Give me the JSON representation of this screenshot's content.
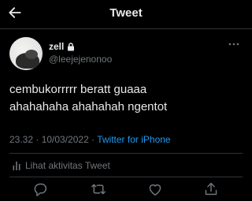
{
  "header": {
    "title": "Tweet"
  },
  "author": {
    "display_name": "zell",
    "handle": "@leejejenonoo"
  },
  "tweet": {
    "line1": "cembukorrrrr beratt guaaa",
    "line2": "ahahahaha ahahahah ngentot",
    "time": "23.32",
    "sep1": " · ",
    "date": "10/03/2022",
    "sep2": " · ",
    "source": "Twitter for iPhone"
  },
  "activity": {
    "label": "Lihat aktivitas Tweet"
  },
  "colors": {
    "background": "#000000",
    "accent": "#1d9bf0",
    "muted": "#71767b"
  },
  "icons": [
    "back-arrow-icon",
    "lock-icon",
    "more-icon",
    "bars-icon",
    "reply-icon",
    "retweet-icon",
    "like-icon",
    "share-icon"
  ]
}
